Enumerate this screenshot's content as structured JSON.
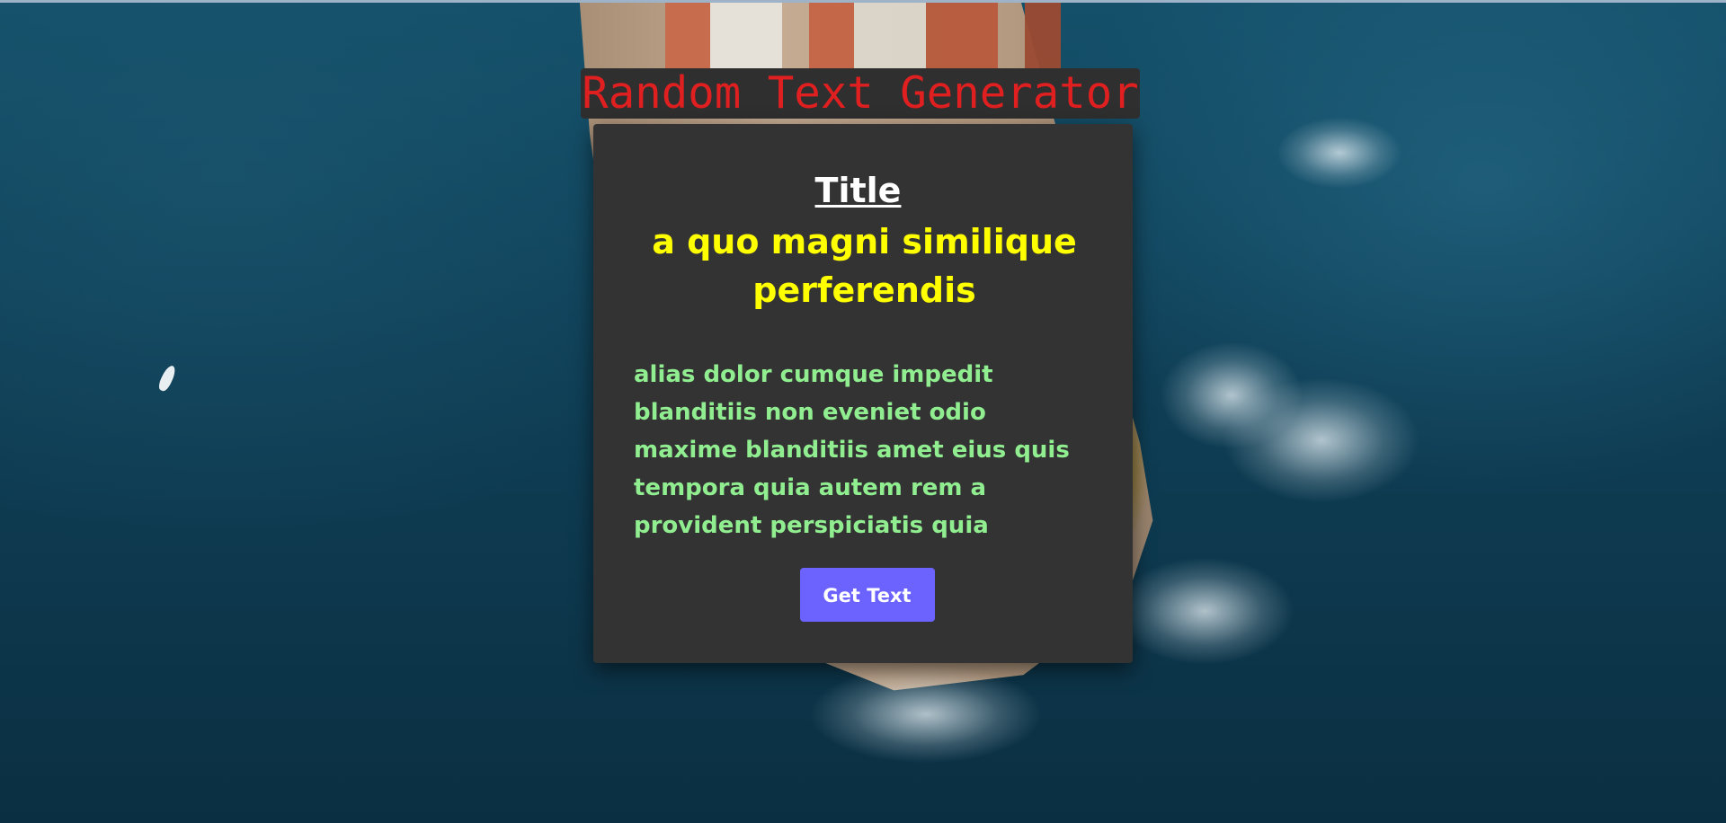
{
  "header": {
    "app_title": "Random Text Generator"
  },
  "card": {
    "label": "Title",
    "title": "a quo magni similique perferendis",
    "body": "alias dolor cumque impedit blanditiis non eveniet odio maxime blanditiis amet eius quis tempora quia autem rem a provident perspiciatis quia",
    "button_label": "Get Text"
  },
  "colors": {
    "app_title_text": "#e02020",
    "panel_background": "#333333",
    "label_text": "#ffffff",
    "title_text": "#ffff00",
    "body_text": "#90ee90",
    "button_background": "#6c63ff",
    "button_text": "#ffffff"
  }
}
